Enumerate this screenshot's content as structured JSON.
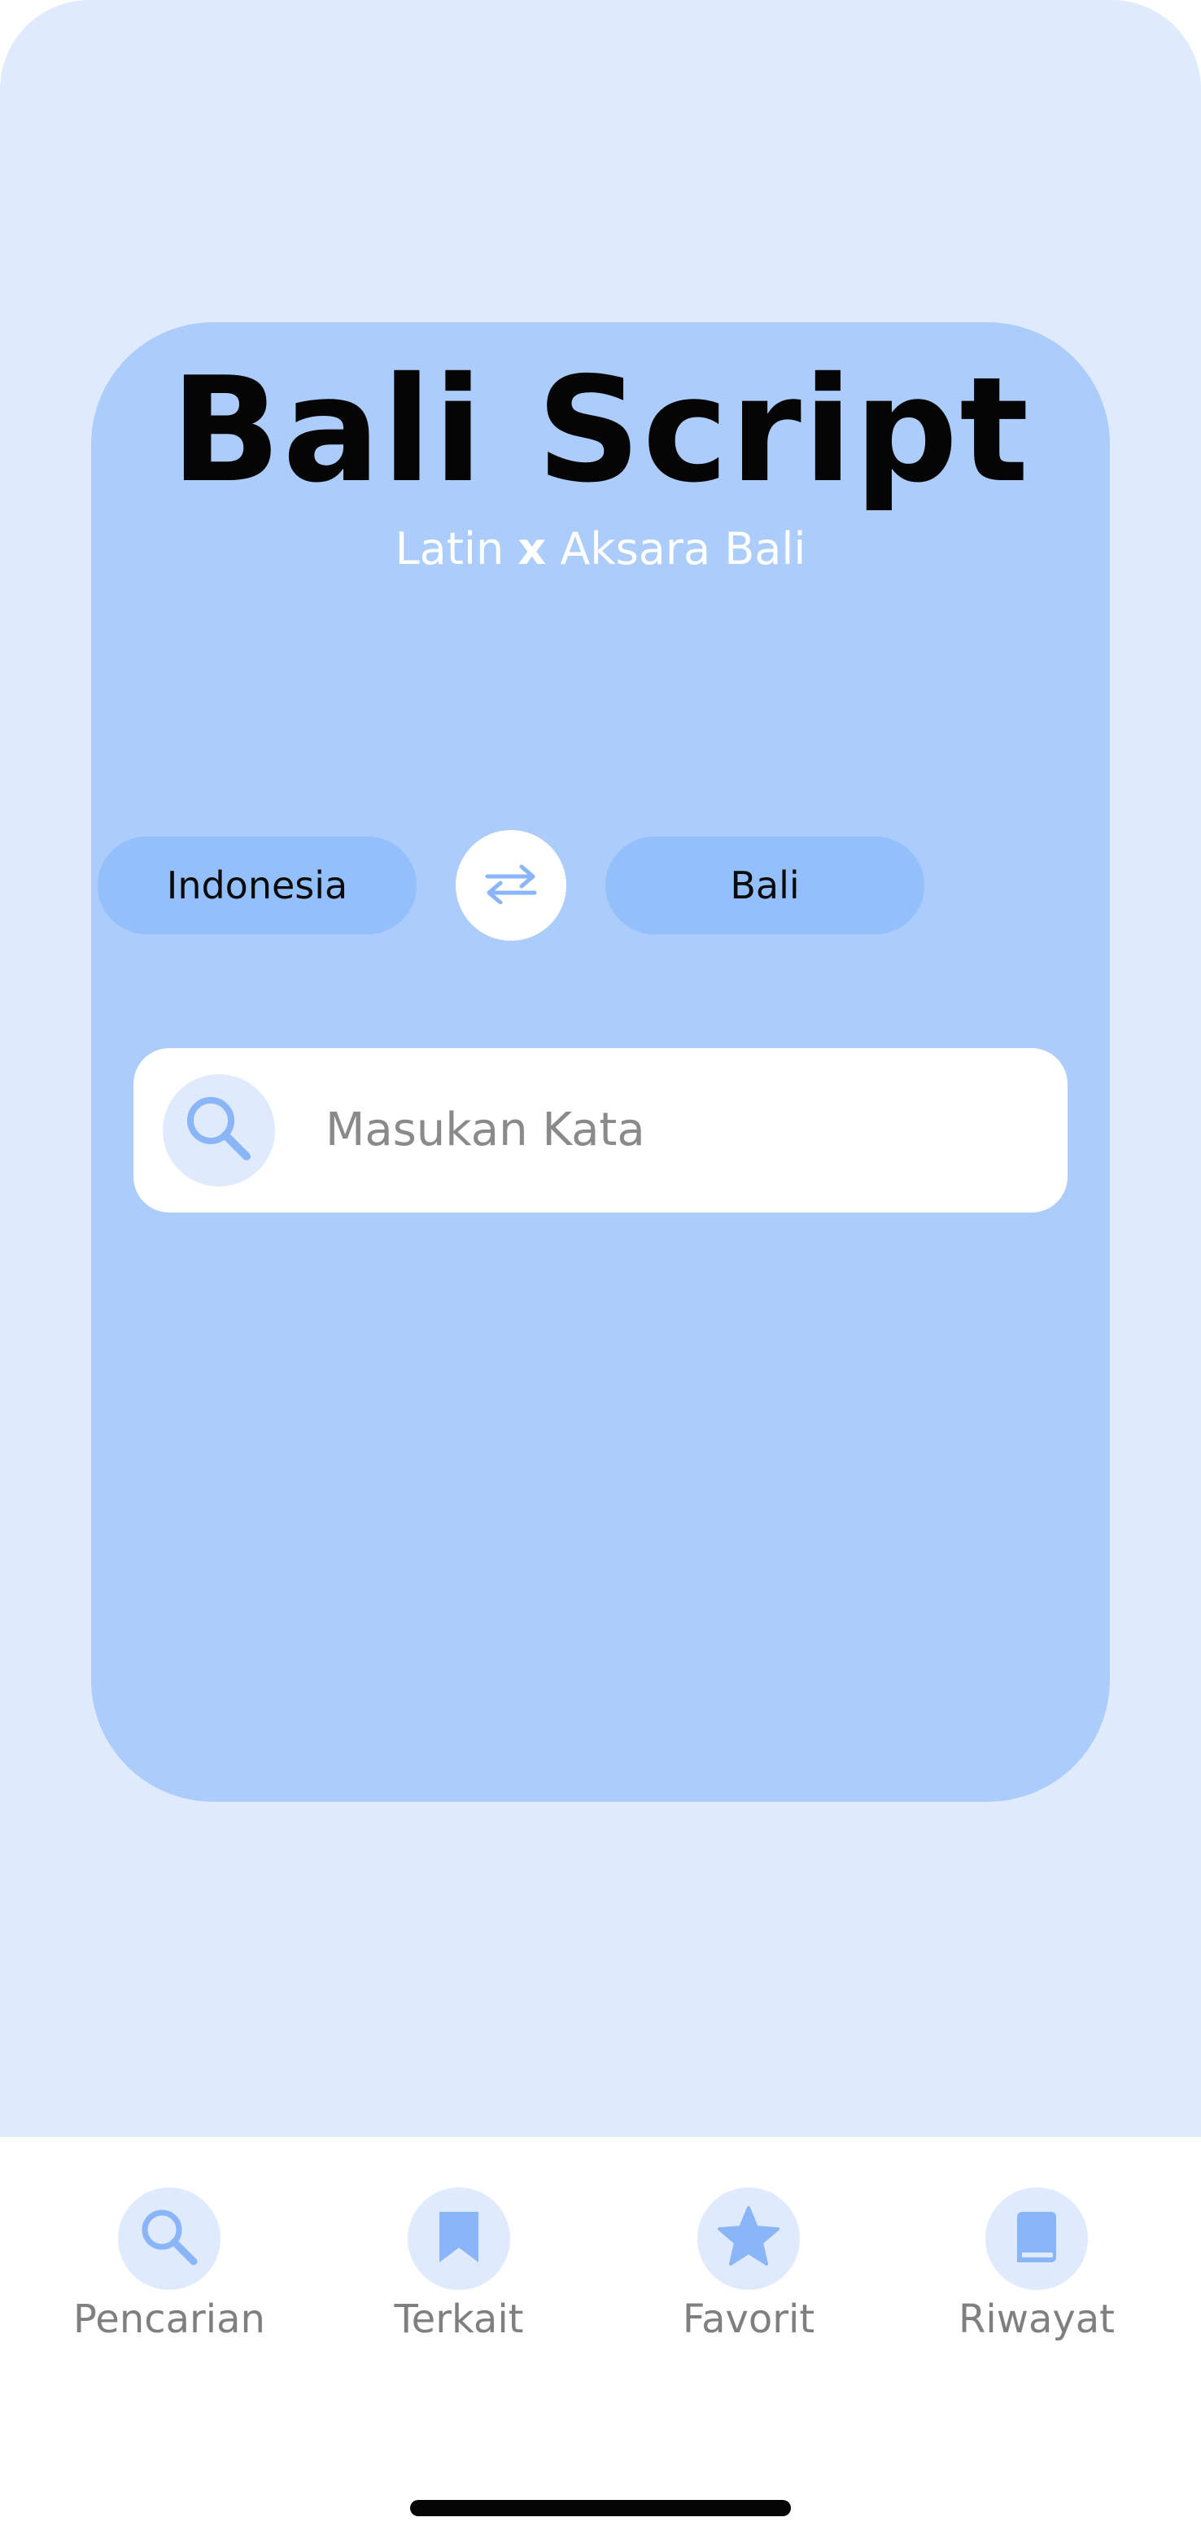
{
  "app": {
    "title": "Bali Script",
    "subtitle_left": "Latin",
    "subtitle_x": "x",
    "subtitle_right": "Aksara Bali"
  },
  "languages": {
    "source": "Indonesia",
    "target": "Bali",
    "swap_icon": "swap-arrows-icon"
  },
  "search": {
    "placeholder": "Masukan Kata",
    "value": "",
    "icon": "search-icon"
  },
  "nav": {
    "items": [
      {
        "label": "Pencarian",
        "icon": "search-icon"
      },
      {
        "label": "Terkait",
        "icon": "bookmark-icon"
      },
      {
        "label": "Favorit",
        "icon": "star-icon"
      },
      {
        "label": "Riwayat",
        "icon": "book-icon"
      }
    ]
  },
  "colors": {
    "background": "#dfebfd",
    "card": "#acccfb",
    "pill": "#93bffa",
    "accent_icon": "#8ab6f9",
    "nav_label": "#7f7f7f"
  }
}
